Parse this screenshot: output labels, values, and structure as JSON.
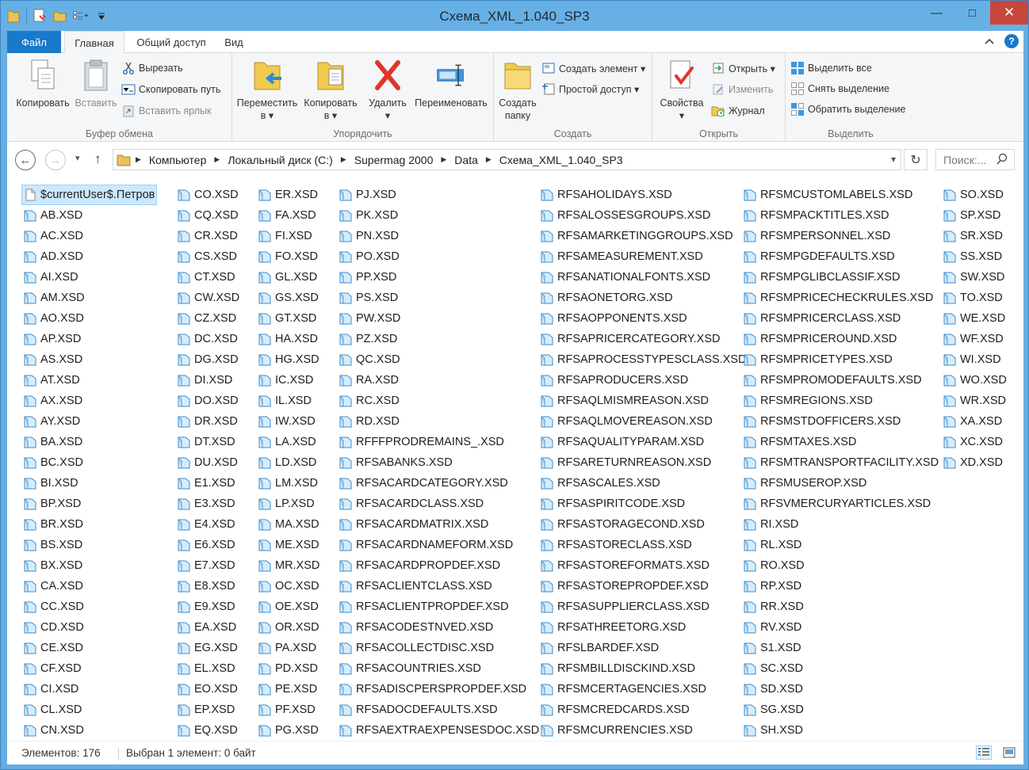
{
  "window": {
    "title": "Схема_XML_1.040_SP3"
  },
  "window_controls": {
    "minimize": "—",
    "maximize": "□",
    "close": "✕"
  },
  "ribbon_tabs": {
    "file": "Файл",
    "home": "Главная",
    "share": "Общий доступ",
    "view": "Вид",
    "help": "?"
  },
  "ribbon": {
    "clipboard": {
      "label": "Буфер обмена",
      "copy": "Копировать",
      "paste": "Вставить",
      "cut": "Вырезать",
      "copy_path": "Скопировать путь",
      "paste_shortcut": "Вставить ярлык"
    },
    "organize": {
      "label": "Упорядочить",
      "move_to_1": "Переместить",
      "move_to_2": "в ▾",
      "copy_to_1": "Копировать",
      "copy_to_2": "в ▾",
      "delete": "Удалить",
      "delete_2": "▾",
      "rename": "Переименовать"
    },
    "create": {
      "label": "Создать",
      "new_folder_1": "Создать",
      "new_folder_2": "папку",
      "new_item": "Создать элемент ▾",
      "easy_access": "Простой доступ ▾"
    },
    "open": {
      "label": "Открыть",
      "properties": "Свойства",
      "properties_2": "▾",
      "open": "Открыть ▾",
      "edit": "Изменить",
      "history": "Журнал"
    },
    "select": {
      "label": "Выделить",
      "select_all": "Выделить все",
      "select_none": "Снять выделение",
      "invert": "Обратить выделение"
    }
  },
  "nav": {
    "back": "←",
    "forward": "→",
    "recent": "▾",
    "up": "↑",
    "refresh": "↻"
  },
  "address": {
    "crumbs": [
      "Компьютер",
      "Локальный диск (C:)",
      "Supermag 2000",
      "Data",
      "Схема_XML_1.040_SP3"
    ],
    "sep": "▶",
    "dropdown": "▾"
  },
  "search": {
    "placeholder": "Поиск:..."
  },
  "files": {
    "col0": [
      "$currentUser$.Петров",
      "AB.XSD",
      "AC.XSD",
      "AD.XSD",
      "AI.XSD",
      "AM.XSD",
      "AO.XSD",
      "AP.XSD",
      "AS.XSD",
      "AT.XSD",
      "AX.XSD",
      "AY.XSD",
      "BA.XSD",
      "BC.XSD",
      "BI.XSD",
      "BP.XSD",
      "BR.XSD",
      "BS.XSD",
      "BX.XSD",
      "CA.XSD",
      "CC.XSD",
      "CD.XSD",
      "CE.XSD",
      "CF.XSD",
      "CI.XSD",
      "CL.XSD",
      "CN.XSD"
    ],
    "col1": [
      "CO.XSD",
      "CQ.XSD",
      "CR.XSD",
      "CS.XSD",
      "CT.XSD",
      "CW.XSD",
      "CZ.XSD",
      "DC.XSD",
      "DG.XSD",
      "DI.XSD",
      "DO.XSD",
      "DR.XSD",
      "DT.XSD",
      "DU.XSD",
      "E1.XSD",
      "E3.XSD",
      "E4.XSD",
      "E6.XSD",
      "E7.XSD",
      "E8.XSD",
      "E9.XSD",
      "EA.XSD",
      "EG.XSD",
      "EL.XSD",
      "EO.XSD",
      "EP.XSD",
      "EQ.XSD"
    ],
    "col2": [
      "ER.XSD",
      "FA.XSD",
      "FI.XSD",
      "FO.XSD",
      "GL.XSD",
      "GS.XSD",
      "GT.XSD",
      "HA.XSD",
      "HG.XSD",
      "IC.XSD",
      "IL.XSD",
      "IW.XSD",
      "LA.XSD",
      "LD.XSD",
      "LM.XSD",
      "LP.XSD",
      "MA.XSD",
      "ME.XSD",
      "MR.XSD",
      "OC.XSD",
      "OE.XSD",
      "OR.XSD",
      "PA.XSD",
      "PD.XSD",
      "PE.XSD",
      "PF.XSD",
      "PG.XSD"
    ],
    "col3": [
      "PJ.XSD",
      "PK.XSD",
      "PN.XSD",
      "PO.XSD",
      "PP.XSD",
      "PS.XSD",
      "PW.XSD",
      "PZ.XSD",
      "QC.XSD",
      "RA.XSD",
      "RC.XSD",
      "RD.XSD",
      "RFFFPRODREMAINS_.XSD",
      "RFSABANKS.XSD",
      "RFSACARDCATEGORY.XSD",
      "RFSACARDCLASS.XSD",
      "RFSACARDMATRIX.XSD",
      "RFSACARDNAMEFORM.XSD",
      "RFSACARDPROPDEF.XSD",
      "RFSACLIENTCLASS.XSD",
      "RFSACLIENTPROPDEF.XSD",
      "RFSACODESTNVED.XSD",
      "RFSACOLLECTDISC.XSD",
      "RFSACOUNTRIES.XSD",
      "RFSADISCPERSPROPDEF.XSD",
      "RFSADOCDEFAULTS.XSD",
      "RFSAEXTRAEXPENSESDOC.XSD"
    ],
    "col4": [
      "RFSAHOLIDAYS.XSD",
      "RFSALOSSESGROUPS.XSD",
      "RFSAMARKETINGGROUPS.XSD",
      "RFSAMEASUREMENT.XSD",
      "RFSANATIONALFONTS.XSD",
      "RFSAONETORG.XSD",
      "RFSAOPPONENTS.XSD",
      "RFSAPRICERCATEGORY.XSD",
      "RFSAPROCESSTYPESCLASS.XSD",
      "RFSAPRODUCERS.XSD",
      "RFSAQLMISMREASON.XSD",
      "RFSAQLMOVEREASON.XSD",
      "RFSAQUALITYPARAM.XSD",
      "RFSARETURNREASON.XSD",
      "RFSASCALES.XSD",
      "RFSASPIRITCODE.XSD",
      "RFSASTORAGECOND.XSD",
      "RFSASTORECLASS.XSD",
      "RFSASTOREFORMATS.XSD",
      "RFSASTOREPROPDEF.XSD",
      "RFSASUPPLIERCLASS.XSD",
      "RFSATHREETORG.XSD",
      "RFSLBARDEF.XSD",
      "RFSMBILLDISCKIND.XSD",
      "RFSMCERTAGENCIES.XSD",
      "RFSMCREDCARDS.XSD",
      "RFSMCURRENCIES.XSD"
    ],
    "col5": [
      "RFSMCUSTOMLABELS.XSD",
      "RFSMPACKTITLES.XSD",
      "RFSMPERSONNEL.XSD",
      "RFSMPGDEFAULTS.XSD",
      "RFSMPGLIBCLASSIF.XSD",
      "RFSMPRICECHECKRULES.XSD",
      "RFSMPRICERCLASS.XSD",
      "RFSMPRICEROUND.XSD",
      "RFSMPRICETYPES.XSD",
      "RFSMPROMODEFAULTS.XSD",
      "RFSMREGIONS.XSD",
      "RFSMSTDOFFICERS.XSD",
      "RFSMTAXES.XSD",
      "RFSMTRANSPORTFACILITY.XSD",
      "RFSMUSEROP.XSD",
      "RFSVMERCURYARTICLES.XSD",
      "RI.XSD",
      "RL.XSD",
      "RO.XSD",
      "RP.XSD",
      "RR.XSD",
      "RV.XSD",
      "S1.XSD",
      "SC.XSD",
      "SD.XSD",
      "SG.XSD",
      "SH.XSD"
    ],
    "col6": [
      "SO.XSD",
      "SP.XSD",
      "SR.XSD",
      "SS.XSD",
      "SW.XSD",
      "TO.XSD",
      "WE.XSD",
      "WF.XSD",
      "WI.XSD",
      "WO.XSD",
      "WR.XSD",
      "XA.XSD",
      "XC.XSD",
      "XD.XSD"
    ]
  },
  "status": {
    "count": "Элементов: 176",
    "selection": "Выбран 1 элемент: 0 байт"
  },
  "colors": {
    "titlebar": "#67b0e5",
    "file_tab": "#1979ca",
    "selection": "#cce8ff",
    "close": "#c7473a"
  }
}
